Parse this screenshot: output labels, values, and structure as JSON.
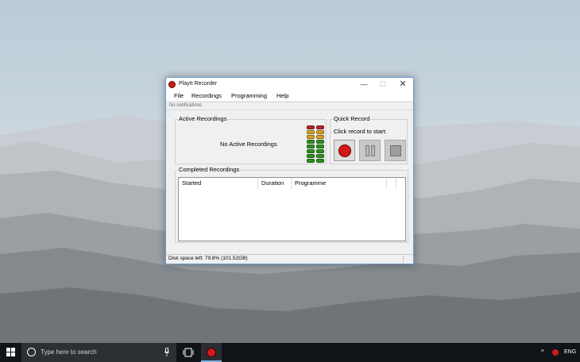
{
  "window": {
    "title": "PlayIt Recorder",
    "minimize_glyph": "—",
    "maximize_glyph": "☐",
    "close_glyph": "✕"
  },
  "menu": [
    "File",
    "Recordings",
    "Programming",
    "Help"
  ],
  "notification": "No notifications",
  "active_recordings": {
    "title": "Active Recordings",
    "empty_text": "No Active Recordings"
  },
  "level_meter": {
    "colors": [
      "#b8232a",
      "#d4a020",
      "#d4a020",
      "#2f8f1f",
      "#2f8f1f",
      "#2f8f1f",
      "#2f8f1f",
      "#2f8f1f"
    ]
  },
  "quick_record": {
    "title": "Quick Record",
    "label": "Click record to start:",
    "buttons": [
      "record-icon",
      "pause-icon",
      "stop-icon"
    ]
  },
  "completed_recordings": {
    "title": "Completed Recordings",
    "columns": [
      "Started",
      "Duration",
      "Programme",
      ""
    ]
  },
  "status": {
    "disk_space": "Disk space left: 79.8% (101.52GB)"
  },
  "taskbar": {
    "search_placeholder": "Type here to search",
    "language": "ENG",
    "tray_chevron": "^"
  },
  "colors": {
    "record_red": "#d11a1a",
    "window_border": "#6d9ccf",
    "taskbar_bg": "#101418"
  }
}
